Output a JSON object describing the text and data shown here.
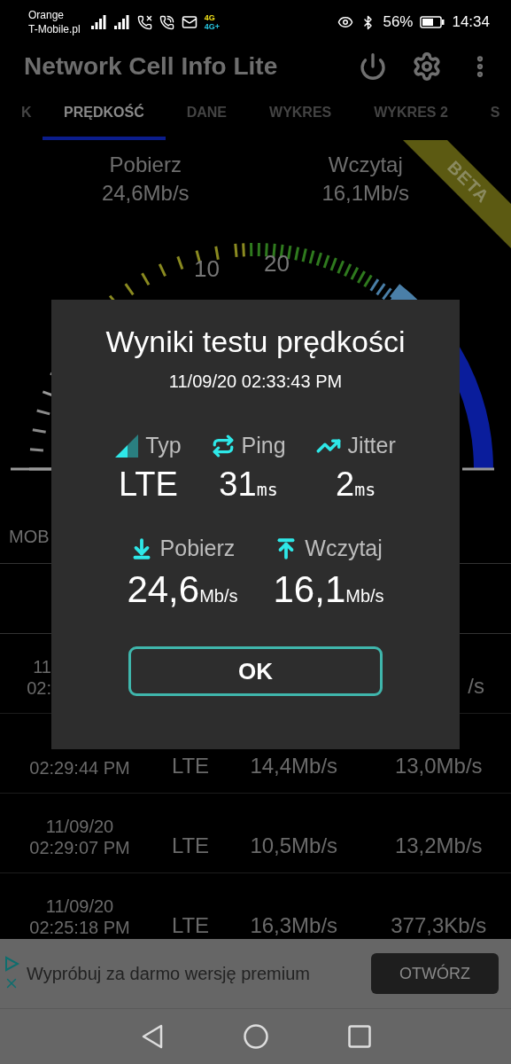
{
  "status_bar": {
    "carriers": [
      "Orange",
      "T-Mobile.pl"
    ],
    "network_badges": [
      "4G",
      "4G+"
    ],
    "battery_percent": "56%",
    "time": "14:34"
  },
  "app_bar": {
    "title": "Network Cell Info Lite"
  },
  "tabs": [
    {
      "label": "K",
      "selected": false
    },
    {
      "label": "PRĘDKOŚĆ",
      "selected": true
    },
    {
      "label": "DANE",
      "selected": false
    },
    {
      "label": "WYKRES",
      "selected": false
    },
    {
      "label": "WYKRES 2",
      "selected": false
    },
    {
      "label": "S",
      "selected": false
    }
  ],
  "summary": [
    {
      "label": "Pobierz",
      "value": "24,6Mb/s"
    },
    {
      "label": "Wczytaj",
      "value": "16,1Mb/s"
    }
  ],
  "ribbon": "BETA",
  "gauge": {
    "labels": [
      "10",
      "20"
    ]
  },
  "section_label": "MOB",
  "history_rows": [
    {
      "kind": "clipped",
      "date": "11",
      "time": "02:",
      "upload": "/s"
    },
    {
      "kind": "full",
      "time": "02:29:44 PM",
      "type": "LTE",
      "download": "14,4Mb/s",
      "upload": "13,0Mb/s"
    },
    {
      "kind": "full",
      "date": "11/09/20",
      "time": "02:29:07 PM",
      "type": "LTE",
      "download": "10,5Mb/s",
      "upload": "13,2Mb/s"
    },
    {
      "kind": "full",
      "date": "11/09/20",
      "time": "02:25:18 PM",
      "type": "LTE",
      "download": "16,3Mb/s",
      "upload": "377,3Kb/s"
    }
  ],
  "dialog": {
    "title": "Wyniki testu prędkości",
    "timestamp": "11/09/20 02:33:43 PM",
    "stats": [
      {
        "kind": "type",
        "label": "Typ",
        "value": "LTE"
      },
      {
        "kind": "ping",
        "label": "Ping",
        "value": "31",
        "unit": "ms"
      },
      {
        "kind": "jitter",
        "label": "Jitter",
        "value": "2",
        "unit": "ms"
      }
    ],
    "speeds": [
      {
        "kind": "download",
        "label": "Pobierz",
        "value": "24,6",
        "unit": "Mb/s"
      },
      {
        "kind": "upload",
        "label": "Wczytaj",
        "value": "16,1",
        "unit": "Mb/s"
      }
    ],
    "button": "OK"
  },
  "ad": {
    "text": "Wypróbuj za darmo wersję premium",
    "button": "OTWÓRZ"
  }
}
